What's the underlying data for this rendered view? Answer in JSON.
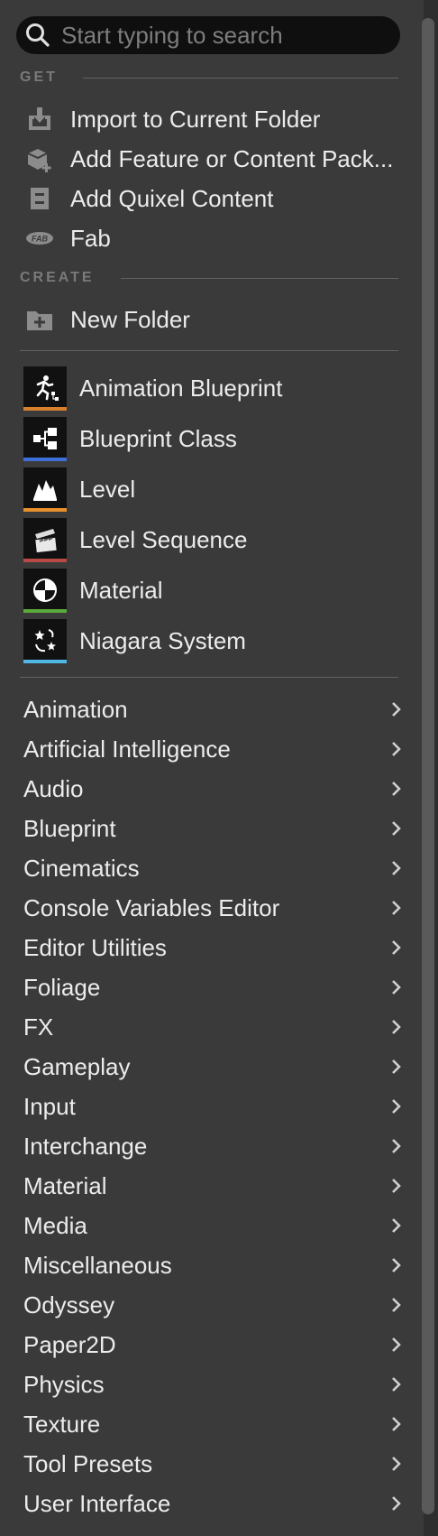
{
  "search": {
    "placeholder": "Start typing to search"
  },
  "sections": {
    "get": "GET",
    "create": "CREATE"
  },
  "get_items": [
    {
      "label": "Import to Current Folder",
      "icon": "import-icon"
    },
    {
      "label": "Add Feature or Content Pack...",
      "icon": "content-pack-icon"
    },
    {
      "label": "Add Quixel Content",
      "icon": "quixel-icon"
    },
    {
      "label": "Fab",
      "icon": "fab-icon"
    }
  ],
  "create_items": [
    {
      "label": "New Folder",
      "icon": "new-folder-icon"
    }
  ],
  "assets": [
    {
      "label": "Animation Blueprint",
      "icon": "animation-blueprint-icon",
      "color": "#d7802e"
    },
    {
      "label": "Blueprint Class",
      "icon": "blueprint-class-icon",
      "color": "#3f6fd8"
    },
    {
      "label": "Level",
      "icon": "level-icon",
      "color": "#e8902c"
    },
    {
      "label": "Level Sequence",
      "icon": "level-sequence-icon",
      "color": "#b74a46"
    },
    {
      "label": "Material",
      "icon": "material-icon",
      "color": "#5aaa3c"
    },
    {
      "label": "Niagara System",
      "icon": "niagara-system-icon",
      "color": "#4fb6e6"
    }
  ],
  "categories": [
    "Animation",
    "Artificial Intelligence",
    "Audio",
    "Blueprint",
    "Cinematics",
    "Console Variables Editor",
    "Editor Utilities",
    "Foliage",
    "FX",
    "Gameplay",
    "Input",
    "Interchange",
    "Material",
    "Media",
    "Miscellaneous",
    "Odyssey",
    "Paper2D",
    "Physics",
    "Texture",
    "Tool Presets",
    "User Interface"
  ],
  "colors": {
    "menu_bg": "#3a3a3a",
    "search_bg": "#0f0f0f",
    "text": "#ececec",
    "muted": "#7a7a7a"
  }
}
